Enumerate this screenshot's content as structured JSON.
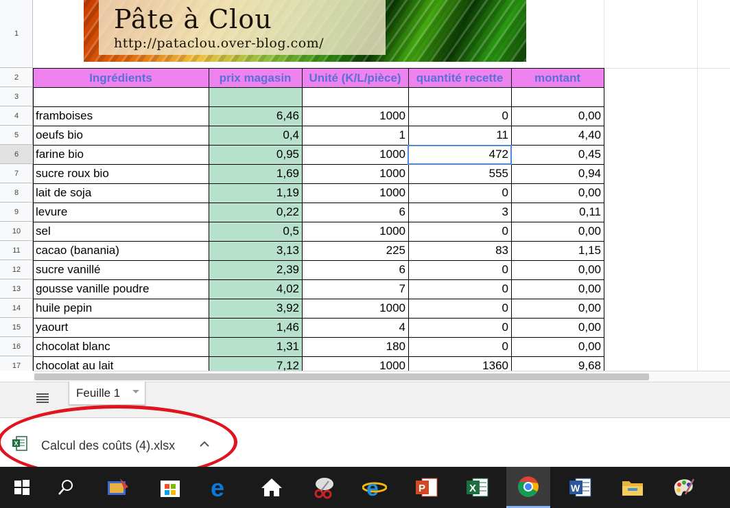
{
  "banner": {
    "title": "Pâte à Clou",
    "url": "http://pataclou.over-blog.com/"
  },
  "row_numbers": [
    "1",
    "2",
    "3",
    "4",
    "5",
    "6",
    "7",
    "8",
    "9",
    "10",
    "11",
    "12",
    "13",
    "14",
    "15",
    "16",
    "17"
  ],
  "headers": [
    "Ingrédients",
    "prix magasin",
    "Unité (K/L/pièce)",
    "quantité recette",
    "montant"
  ],
  "rows": [
    {
      "ingredient": "framboises",
      "prix": "6,46",
      "unite": "1000",
      "quantite": "0",
      "montant": "0,00"
    },
    {
      "ingredient": "oeufs bio",
      "prix": "0,4",
      "unite": "1",
      "quantite": "11",
      "montant": "4,40"
    },
    {
      "ingredient": "farine bio",
      "prix": "0,95",
      "unite": "1000",
      "quantite": "472",
      "montant": "0,45"
    },
    {
      "ingredient": "sucre roux bio",
      "prix": "1,69",
      "unite": "1000",
      "quantite": "555",
      "montant": "0,94"
    },
    {
      "ingredient": "lait de soja",
      "prix": "1,19",
      "unite": "1000",
      "quantite": "0",
      "montant": "0,00"
    },
    {
      "ingredient": "levure",
      "prix": "0,22",
      "unite": "6",
      "quantite": "3",
      "montant": "0,11"
    },
    {
      "ingredient": "sel",
      "prix": "0,5",
      "unite": "1000",
      "quantite": "0",
      "montant": "0,00"
    },
    {
      "ingredient": "cacao (banania)",
      "prix": "3,13",
      "unite": "225",
      "quantite": "83",
      "montant": "1,15"
    },
    {
      "ingredient": "sucre vanillé",
      "prix": "2,39",
      "unite": "6",
      "quantite": "0",
      "montant": "0,00"
    },
    {
      "ingredient": "gousse vanille poudre",
      "prix": "4,02",
      "unite": "7",
      "quantite": "0",
      "montant": "0,00"
    },
    {
      "ingredient": "huile pepin",
      "prix": "3,92",
      "unite": "1000",
      "quantite": "0",
      "montant": "0,00"
    },
    {
      "ingredient": "yaourt",
      "prix": "1,46",
      "unite": "4",
      "quantite": "0",
      "montant": "0,00"
    },
    {
      "ingredient": "chocolat blanc",
      "prix": "1,31",
      "unite": "180",
      "quantite": "0",
      "montant": "0,00"
    },
    {
      "ingredient": "chocolat au lait",
      "prix": "7,12",
      "unite": "1000",
      "quantite": "1360",
      "montant": "9,68"
    }
  ],
  "selected_row": "6",
  "colors": {
    "header_bg": "#ee82ee",
    "header_text": "#5a6fd8",
    "price_bg": "#b7e1cd",
    "selection": "#4a89dc",
    "annotation": "#e0141e"
  },
  "sheet_tab": {
    "label": "Feuille 1"
  },
  "download": {
    "filename": "Calcul des coûts (4).xlsx"
  },
  "taskbar": {
    "icons": [
      "windows-start-icon",
      "search-icon",
      "media-app-icon",
      "store-icon",
      "edge-icon",
      "home-icon",
      "snipping-tool-icon",
      "internet-explorer-icon",
      "powerpoint-icon",
      "excel-icon",
      "chrome-icon",
      "word-icon",
      "file-explorer-icon",
      "paint-icon"
    ],
    "active": "chrome-icon"
  }
}
